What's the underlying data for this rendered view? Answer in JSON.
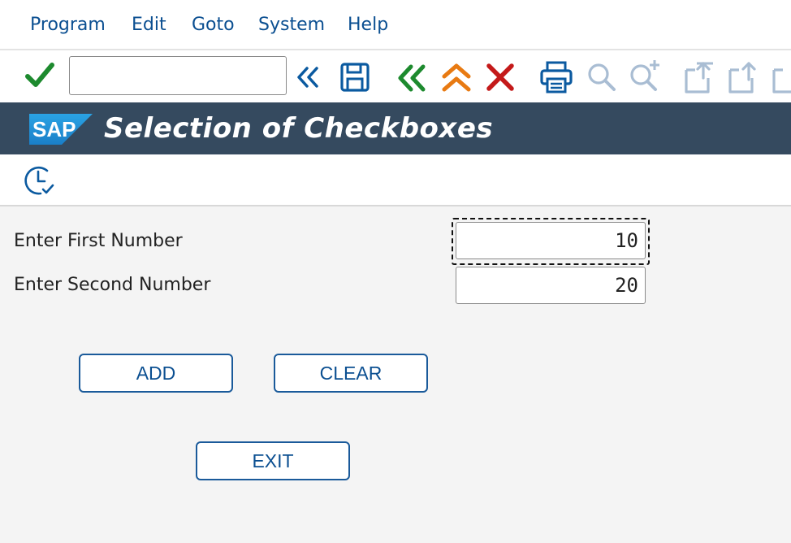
{
  "menu": {
    "items": [
      {
        "label": "Program"
      },
      {
        "label": "Edit"
      },
      {
        "label": "Goto"
      },
      {
        "label": "System"
      },
      {
        "label": "Help"
      }
    ]
  },
  "toolbar": {
    "command_value": "",
    "icons": [
      "enter-icon",
      "double-chevron-left-icon",
      "save-icon",
      "back-icon",
      "exit-up-icon",
      "cancel-icon",
      "print-icon",
      "find-icon",
      "find-next-icon",
      "first-page-icon",
      "previous-page-icon"
    ]
  },
  "header": {
    "logo_text": "SAP",
    "title": "Selection of Checkboxes"
  },
  "app_toolbar": {
    "icons": [
      "execute-icon"
    ]
  },
  "form": {
    "first_label": "Enter First Number",
    "first_value": "10",
    "second_label": "Enter Second Number",
    "second_value": "20"
  },
  "buttons": {
    "add": "ADD",
    "clear": "CLEAR",
    "exit": "EXIT"
  },
  "colors": {
    "title_bar": "#354a5f",
    "menu_text": "#0b4f91",
    "enter_green": "#1d8a2e",
    "cancel_red": "#c41a1a",
    "exit_orange": "#e87a12"
  }
}
